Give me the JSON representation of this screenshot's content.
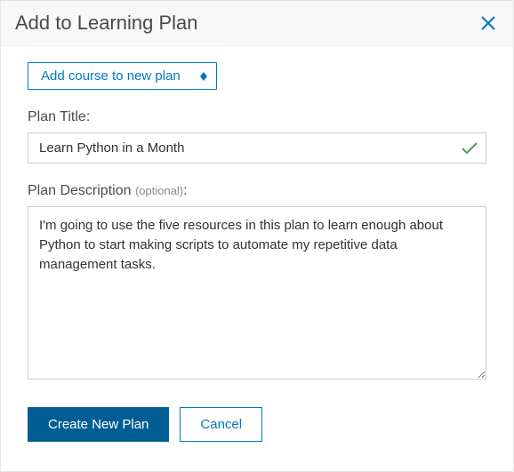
{
  "header": {
    "title": "Add to Learning Plan"
  },
  "dropdown": {
    "selected_label": "Add course to new plan"
  },
  "plan_title": {
    "label": "Plan Title:",
    "value": "Learn Python in a Month"
  },
  "plan_description": {
    "label": "Plan Description ",
    "optional": "(optional)",
    "colon": ":",
    "value": "I'm going to use the five resources in this plan to learn enough about Python to start making scripts to automate my repetitive data management tasks."
  },
  "buttons": {
    "create": "Create New Plan",
    "cancel": "Cancel"
  }
}
